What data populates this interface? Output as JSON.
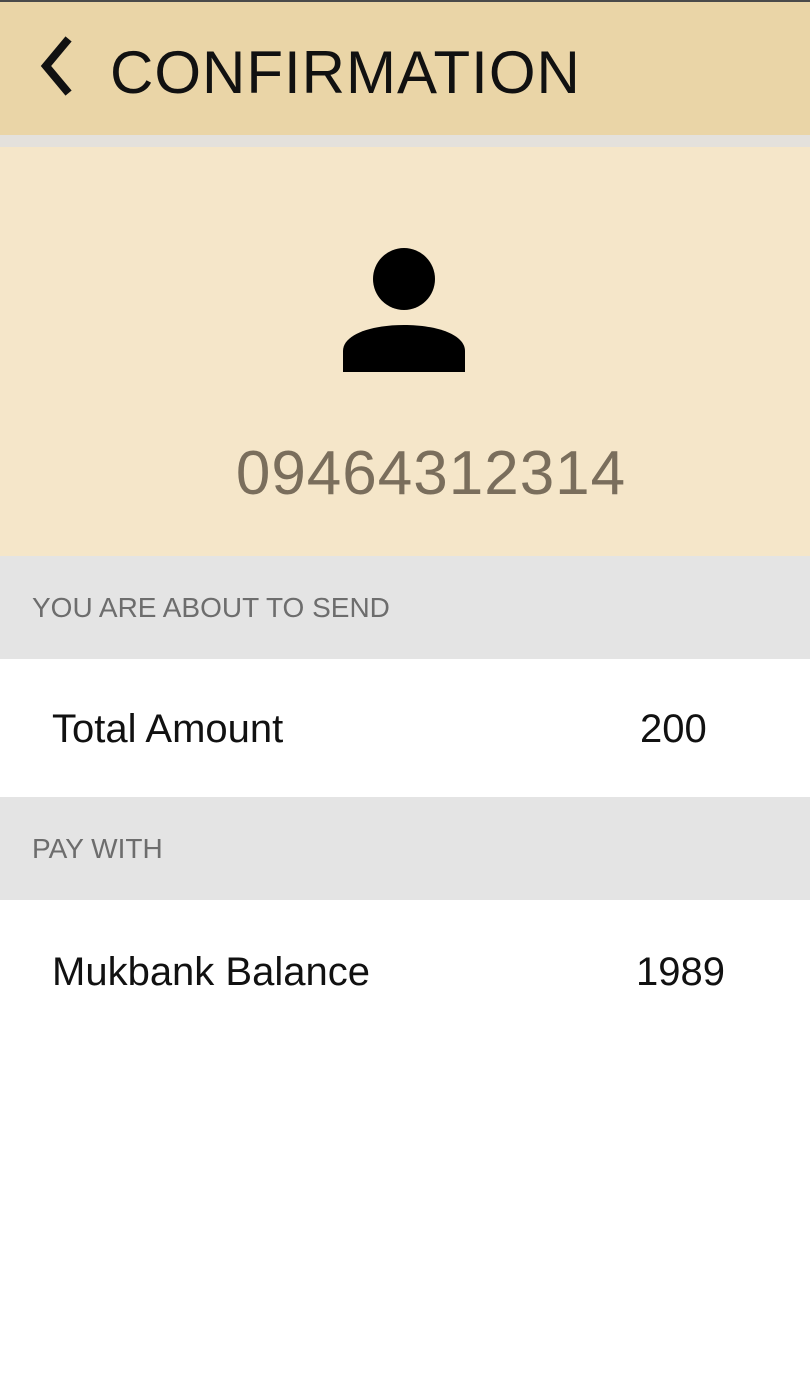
{
  "header": {
    "title": "CONFIRMATION",
    "back_icon": "chevron-left-icon"
  },
  "recipient": {
    "avatar_icon": "person-icon",
    "number": "09464312314"
  },
  "send_section": {
    "header": "YOU ARE ABOUT TO SEND",
    "total_label": "Total Amount",
    "total_value": "200"
  },
  "pay_section": {
    "header": "PAY WITH",
    "source_label": "Mukbank Balance",
    "source_value": "1989"
  },
  "colors": {
    "app_bar": "#ead5a7",
    "recipient_panel": "#f5e6c9",
    "section_header": "#e4e4e4",
    "number_text": "#7a6e5c"
  }
}
